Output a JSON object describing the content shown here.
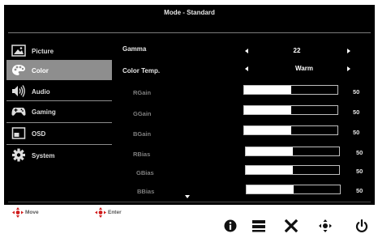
{
  "osd": {
    "title": "Mode - Standard",
    "sidebar": [
      {
        "label": "Picture",
        "icon": "picture-icon",
        "selected": false
      },
      {
        "label": "Color",
        "icon": "palette-icon",
        "selected": true
      },
      {
        "label": "Audio",
        "icon": "speaker-icon",
        "selected": false
      },
      {
        "label": "Gaming",
        "icon": "gamepad-icon",
        "selected": false
      },
      {
        "label": "OSD",
        "icon": "osd-window-icon",
        "selected": false
      },
      {
        "label": "System",
        "icon": "gear-icon",
        "selected": false
      }
    ],
    "settings": {
      "gamma": {
        "label": "Gamma",
        "value": "22"
      },
      "color_temp": {
        "label": "Color Temp.",
        "value": "Warm"
      }
    },
    "sliders": [
      {
        "label": "RGain",
        "value": "50",
        "level": 0.5
      },
      {
        "label": "GGain",
        "value": "50",
        "level": 0.5
      },
      {
        "label": "BGain",
        "value": "50",
        "level": 0.5
      },
      {
        "label": "RBias",
        "value": "50",
        "level": 0.5
      },
      {
        "label": "GBias",
        "value": "50",
        "level": 0.5
      },
      {
        "label": "BBias",
        "value": "50",
        "level": 0.5
      }
    ]
  },
  "hints": {
    "move": "Move",
    "enter": "Enter"
  },
  "keys": [
    "info-icon",
    "menu-icon",
    "close-icon",
    "navigate-icon",
    "power-icon"
  ],
  "colors": {
    "background": "#000000",
    "selected": "#8e8e8e",
    "text": "#e6e6e6",
    "muted": "#7f7f7f",
    "accent_red": "#d01c1c"
  }
}
